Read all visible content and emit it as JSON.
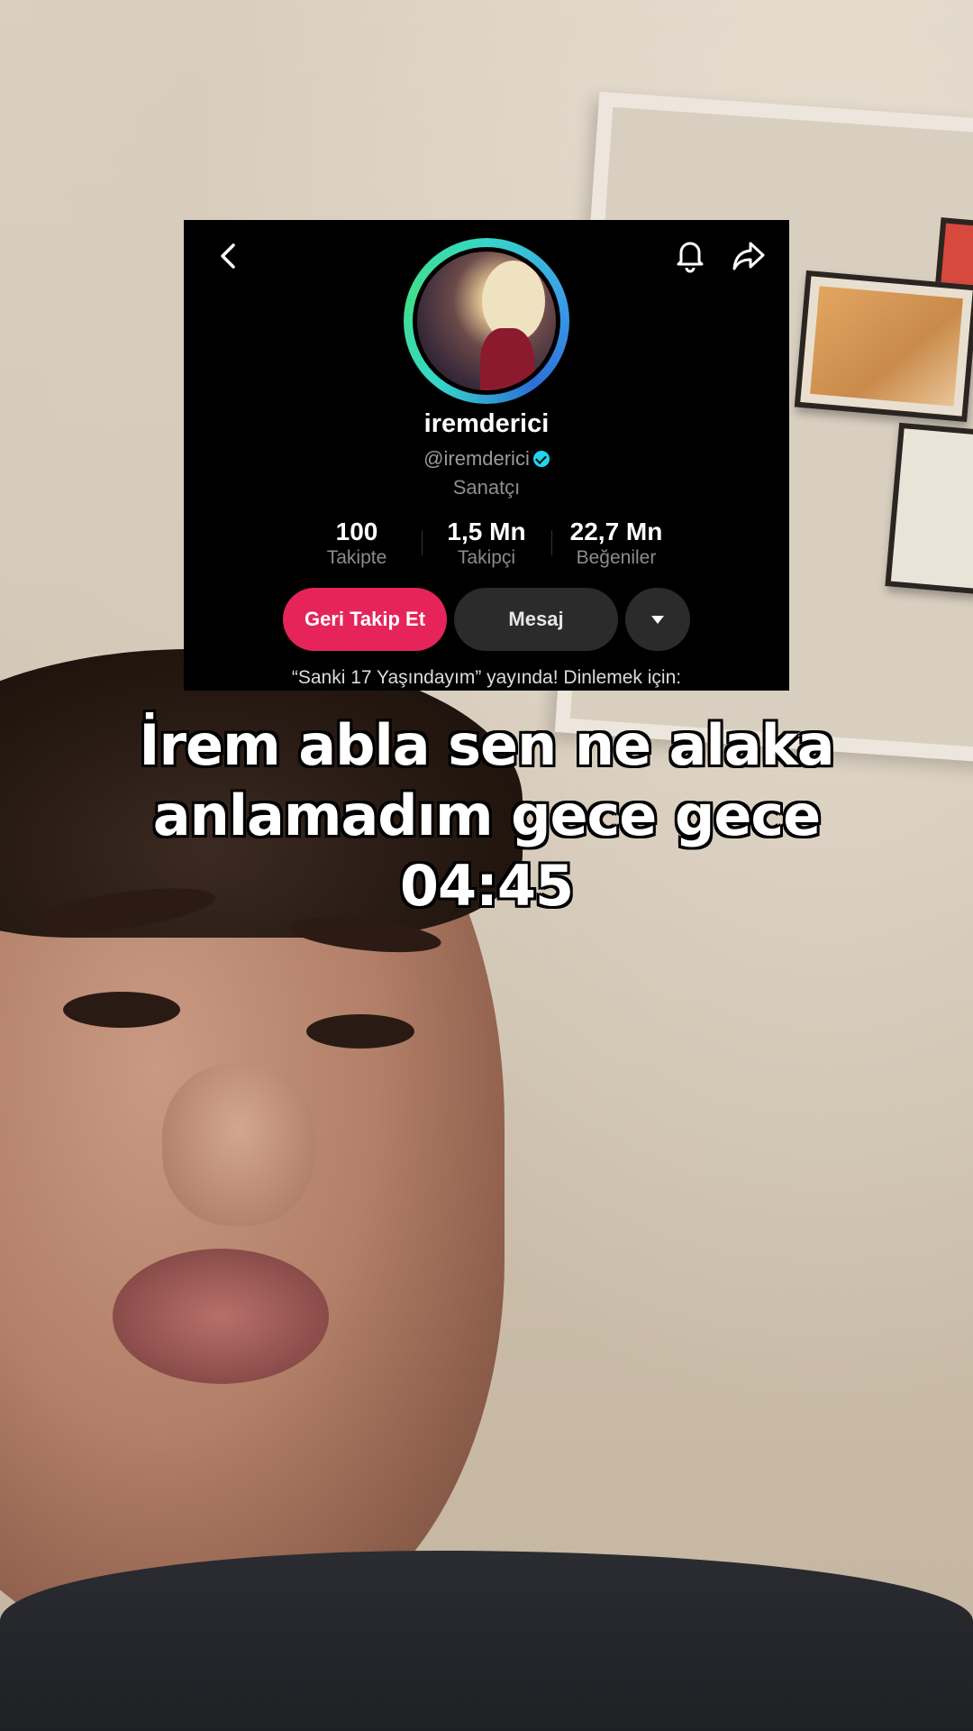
{
  "profile": {
    "username": "iremderici",
    "handle": "@iremderici",
    "category": "Sanatçı",
    "stats": [
      {
        "value": "100",
        "label": "Takipte"
      },
      {
        "value": "1,5 Mn",
        "label": "Takipçi"
      },
      {
        "value": "22,7 Mn",
        "label": "Beğeniler"
      }
    ],
    "follow_back_label": "Geri Takip Et",
    "message_label": "Mesaj",
    "bio": "“Sanki 17 Yaşındayım” yayında! Dinlemek için:"
  },
  "caption": {
    "line1": "İrem abla sen ne alaka",
    "line2": "anlamadım gece gece",
    "line3": "04:45"
  },
  "icons": {
    "back": "chevron-left-icon",
    "notifications": "bell-icon",
    "share": "share-icon",
    "verified": "verified-badge-icon",
    "more": "caret-down-icon"
  },
  "colors": {
    "follow_button": "#e6245a",
    "verified_badge": "#20d5ec",
    "secondary_button": "#2b2b2b"
  }
}
